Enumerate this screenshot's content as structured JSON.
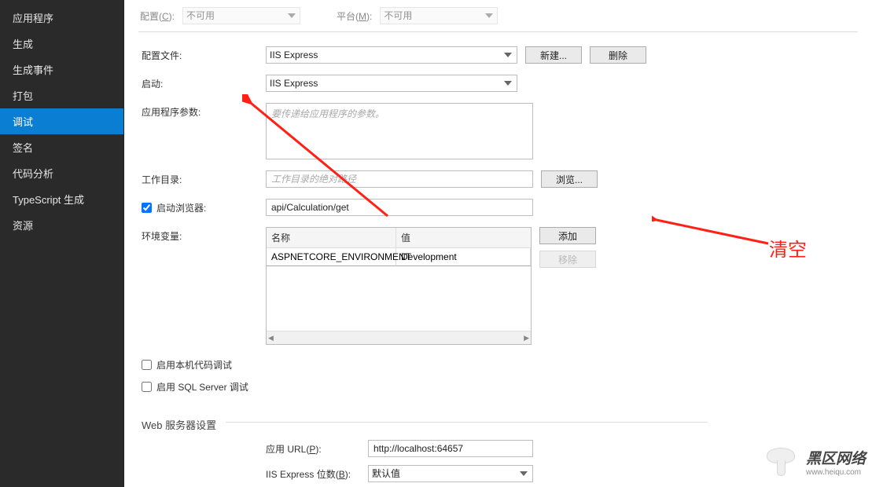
{
  "sidebar": {
    "items": [
      {
        "label": "应用程序"
      },
      {
        "label": "生成"
      },
      {
        "label": "生成事件"
      },
      {
        "label": "打包"
      },
      {
        "label": "调试",
        "selected": true
      },
      {
        "label": "签名"
      },
      {
        "label": "代码分析"
      },
      {
        "label": "TypeScript 生成"
      },
      {
        "label": "资源"
      }
    ]
  },
  "top": {
    "config_label_pre": "配置(",
    "config_label_key": "C",
    "config_label_post": "):",
    "config_value": "不可用",
    "platform_label_pre": "平台(",
    "platform_label_key": "M",
    "platform_label_post": "):",
    "platform_value": "不可用"
  },
  "form": {
    "profile_label": "配置文件:",
    "profile_value": "IIS Express",
    "new_btn": "新建...",
    "delete_btn": "删除",
    "launch_label": "启动:",
    "launch_value": "IIS Express",
    "app_args_label": "应用程序参数:",
    "app_args_placeholder": "要传递给应用程序的参数。",
    "workdir_label": "工作目录:",
    "workdir_placeholder": "工作目录的绝对路径",
    "browse_btn": "浏览...",
    "launch_browser_label": "启动浏览器:",
    "launch_browser_checked": true,
    "launch_browser_value": "api/Calculation/get",
    "env_label": "环境变量:",
    "env_col_name": "名称",
    "env_col_value": "值",
    "env_rows": [
      {
        "name": "ASPNETCORE_ENVIRONMENT",
        "value": "Development"
      }
    ],
    "add_btn": "添加",
    "remove_btn": "移除",
    "native_debug_label": "启用本机代码调试",
    "sql_debug_label": "启用 SQL Server 调试",
    "web_section": "Web 服务器设置",
    "app_url_label_pre": "应用 URL(",
    "app_url_label_key": "P",
    "app_url_label_post": "):",
    "app_url_value": "http://localhost:64657",
    "iis_bits_label_pre": "IIS Express 位数(",
    "iis_bits_label_key": "B",
    "iis_bits_label_post": "):",
    "iis_bits_value": "默认值"
  },
  "annotations": {
    "clear_text": "清空"
  },
  "watermark": {
    "cn": "黑区网络",
    "en": "www.heiqu.com"
  }
}
